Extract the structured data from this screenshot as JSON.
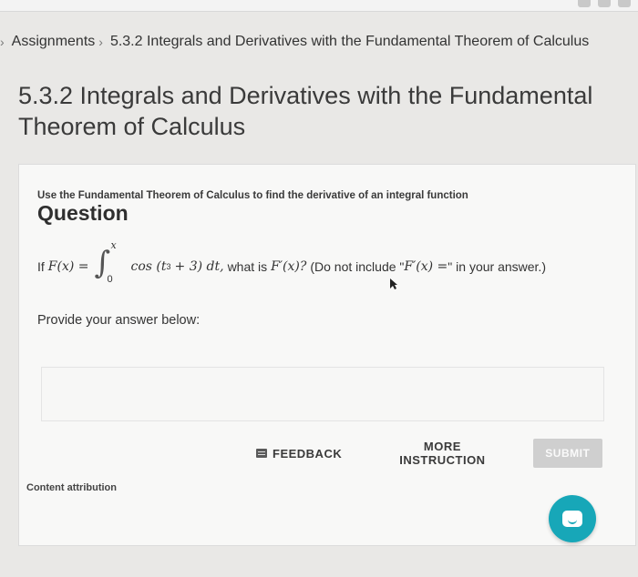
{
  "breadcrumb": {
    "items": [
      {
        "label": "Assignments"
      },
      {
        "label": "5.3.2 Integrals and Derivatives with the Fundamental Theorem of Calculus"
      }
    ]
  },
  "page": {
    "title": "5.3.2 Integrals and Derivatives with the Fundamental Theorem of Calculus"
  },
  "question": {
    "subtitle": "Use the Fundamental Theorem of Calculus to find the derivative of an integral function",
    "heading": "Question",
    "text_prefix": "If",
    "f_def": "F(x) =",
    "upper_limit": "x",
    "lower_limit": "0",
    "integrand_prefix": "cos (t",
    "exponent": "3",
    "integrand_suffix": "+ 3) dt,",
    "text_mid": "what is",
    "fprime": "F′(x)?",
    "text_note_prefix": "(Do not include \"",
    "fprime_eq": "F′(x) =",
    "text_note_suffix": "\" in your answer.)",
    "prompt": "Provide your answer below:"
  },
  "answer": {
    "value": ""
  },
  "actions": {
    "feedback_label": "FEEDBACK",
    "more_label": "MORE INSTRUCTION",
    "submit_label": "SUBMIT"
  },
  "footer": {
    "attribution": "Content attribution"
  },
  "colors": {
    "chat_accent": "#17a7b8",
    "submit_disabled": "#cfcfcf"
  },
  "icons": [
    "chevron-right-icon",
    "feedback-icon",
    "chat-icon",
    "mouse-cursor-icon"
  ]
}
